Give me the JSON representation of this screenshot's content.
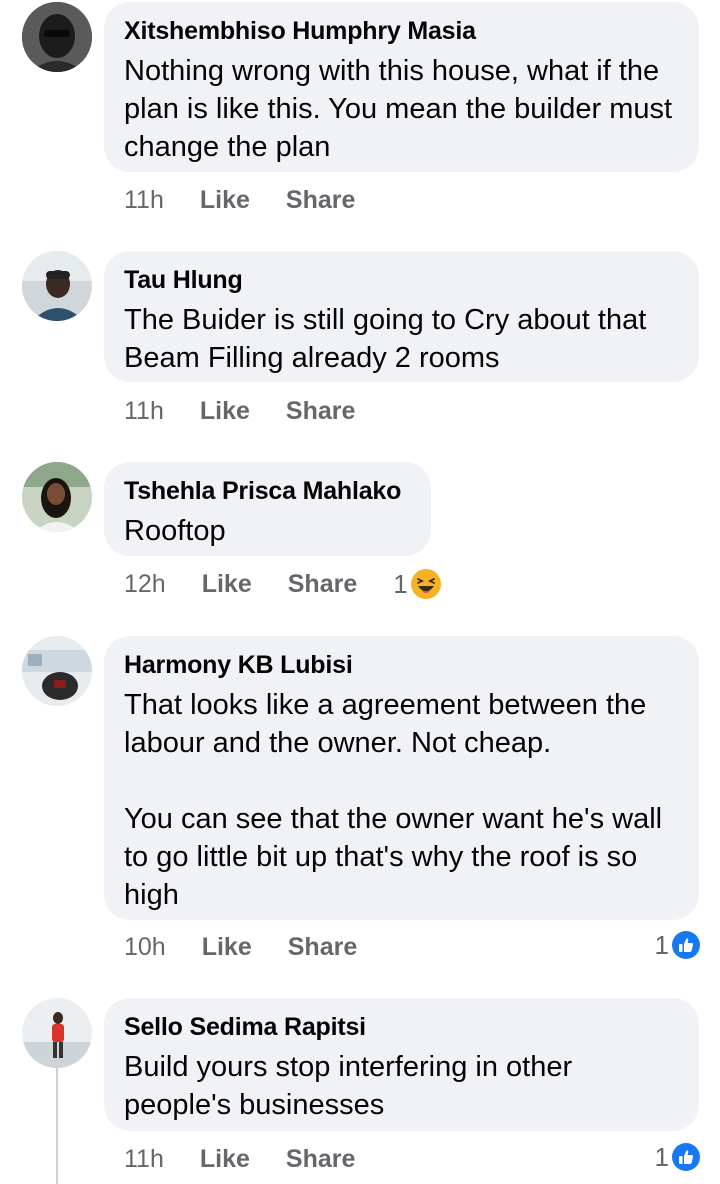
{
  "comments": [
    {
      "name": "Xitshembhiso Humphry Masia",
      "text": "Nothing wrong with this house, what if the plan is like this. You mean the builder must change the plan",
      "time": "11h",
      "like": "Like",
      "share": "Share"
    },
    {
      "name": "Tau Hlung",
      "text": "The Buider is still going to Cry about that Beam Filling already 2 rooms",
      "time": "11h",
      "like": "Like",
      "share": "Share"
    },
    {
      "name": "Tshehla Prisca Mahlako",
      "text": "Rooftop",
      "time": "12h",
      "like": "Like",
      "share": "Share",
      "reaction_count": "1",
      "reaction_icon": "haha-icon"
    },
    {
      "name": "Harmony KB Lubisi",
      "text": "That looks like a agreement between the labour and the owner. Not cheap.\n\nYou can see that the owner want he's wall to go little bit up that's why the roof is so high",
      "time": "10h",
      "like": "Like",
      "share": "Share",
      "reaction_count": "1",
      "reaction_icon": "like-icon"
    },
    {
      "name": "Sello Sedima Rapitsi",
      "text": "Build yours stop interfering in other people's businesses",
      "time": "11h",
      "like": "Like",
      "share": "Share",
      "reaction_count": "1",
      "reaction_icon": "like-icon"
    }
  ],
  "colors": {
    "bubble": "#f0f2f5",
    "meta_text": "#65676b",
    "like_blue": "#1877f2",
    "haha_yellow": "#f7b125"
  }
}
